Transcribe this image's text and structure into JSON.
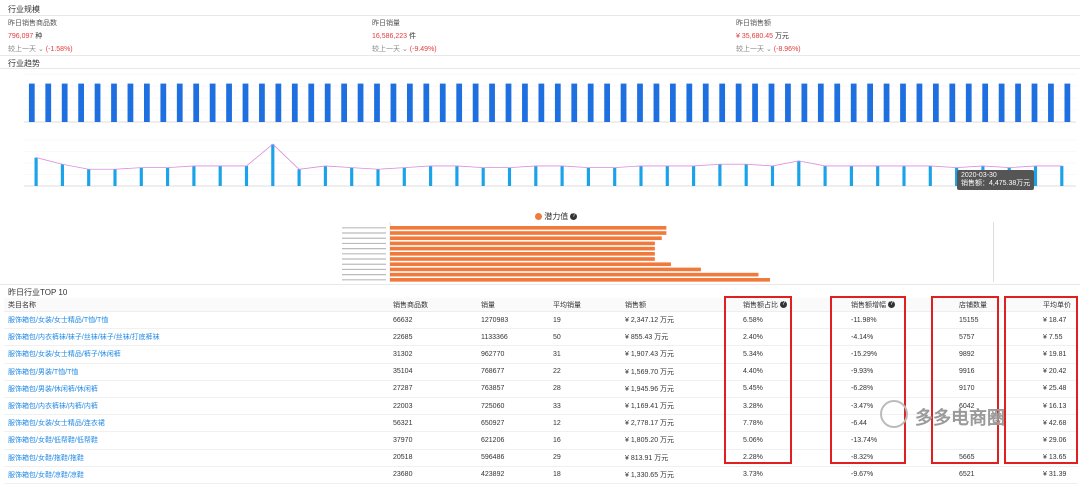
{
  "section_industry_scale": "行业规模",
  "stats": [
    {
      "label": "昨日销售商品数",
      "value": "796,097",
      "unit": "种",
      "compare": "较上一天",
      "pct": "(-1.58%)"
    },
    {
      "label": "昨日销量",
      "value": "16,586,223",
      "unit": "件",
      "compare": "较上一天",
      "pct": "(-9.49%)"
    },
    {
      "label": "昨日销售额",
      "value": "¥ 35,680.45",
      "unit": "万元",
      "compare": "较上一天",
      "pct": "(-8.96%)"
    }
  ],
  "section_trend": "行业趋势",
  "chart_data": [
    {
      "type": "bar",
      "series": [
        {
          "name": "",
          "color": "#1e6fe0",
          "values": [
            28,
            28,
            28,
            28,
            28,
            28,
            28,
            28,
            28,
            28,
            28,
            28,
            28,
            28,
            28,
            28,
            28,
            28,
            28,
            28,
            28,
            28,
            28,
            28,
            28,
            28,
            28,
            28,
            28,
            28,
            28,
            28,
            28,
            28,
            28,
            28,
            28,
            28,
            28,
            28,
            28,
            28,
            28,
            28,
            28,
            28,
            28,
            28,
            28,
            28,
            28,
            28,
            28,
            28,
            28,
            28,
            28,
            28,
            28,
            28,
            28,
            28,
            28,
            28
          ]
        }
      ],
      "ylim": [
        0,
        35
      ]
    },
    {
      "type": "bar",
      "series": [
        {
          "name": "",
          "color": "#1aa3e8",
          "values": [
            34,
            26,
            20,
            20,
            22,
            22,
            24,
            24,
            24,
            50,
            20,
            24,
            22,
            20,
            22,
            24,
            24,
            22,
            22,
            24,
            24,
            22,
            22,
            24,
            24,
            24,
            26,
            26,
            24,
            30,
            24,
            24,
            24,
            24,
            24,
            22,
            24,
            22,
            24,
            24
          ]
        },
        {
          "name": "",
          "color": "#d98ce0",
          "values": [
            34,
            26,
            20,
            20,
            22,
            22,
            24,
            24,
            24,
            50,
            20,
            24,
            22,
            20,
            22,
            24,
            24,
            22,
            22,
            24,
            24,
            22,
            22,
            24,
            24,
            24,
            26,
            26,
            24,
            30,
            24,
            24,
            24,
            24,
            24,
            22,
            24,
            22,
            24,
            24
          ]
        }
      ],
      "ylim": [
        0,
        55
      ]
    },
    {
      "type": "bar",
      "title": "潜力值",
      "series": [
        {
          "name": "",
          "color": "#f07a3c",
          "values": [
            120,
            120,
            118,
            115,
            115,
            115,
            115,
            122,
            135,
            160,
            165
          ]
        }
      ]
    }
  ],
  "potential_title": "潜力值",
  "tooltip": "2020-03-30\n销售额：4,475.38万元",
  "top10_title": "昨日行业TOP 10",
  "table": {
    "headers": [
      "类目名称",
      "销售商品数",
      "销量",
      "平均销量",
      "销售额",
      "销售额占比",
      "销售额增幅",
      "店铺数量",
      "平均单价"
    ],
    "rows": [
      [
        "服饰箱包/女装/女士精品/T恤/T恤",
        "66632",
        "1270983",
        "19",
        "¥ 2,347.12 万元",
        "6.58%",
        "-11.98%",
        "15155",
        "¥ 18.47"
      ],
      [
        "服饰箱包/内衣裤袜/袜子/丝袜/袜子/丝袜/打底裤袜",
        "22685",
        "1133366",
        "50",
        "¥ 855.43 万元",
        "2.40%",
        "-4.14%",
        "5757",
        "¥ 7.55"
      ],
      [
        "服饰箱包/女装/女士精品/裤子/休闲裤",
        "31302",
        "962770",
        "31",
        "¥ 1,907.43 万元",
        "5.34%",
        "-15.29%",
        "9892",
        "¥ 19.81"
      ],
      [
        "服饰箱包/男装/T恤/T恤",
        "35104",
        "768677",
        "22",
        "¥ 1,569.70 万元",
        "4.40%",
        "-9.93%",
        "9916",
        "¥ 20.42"
      ],
      [
        "服饰箱包/男装/休闲裤/休闲裤",
        "27287",
        "763857",
        "28",
        "¥ 1,945.96 万元",
        "5.45%",
        "-6.28%",
        "9170",
        "¥ 25.48"
      ],
      [
        "服饰箱包/内衣裤袜/内裤/内裤",
        "22003",
        "725060",
        "33",
        "¥ 1,169.41 万元",
        "3.28%",
        "-3.47%",
        "6042",
        "¥ 16.13"
      ],
      [
        "服饰箱包/女装/女士精品/连衣裙",
        "56321",
        "650927",
        "12",
        "¥ 2,778.17 万元",
        "7.78%",
        "-6.44",
        "",
        "¥ 42.68"
      ],
      [
        "服饰箱包/女鞋/低帮鞋/低帮鞋",
        "37970",
        "621206",
        "16",
        "¥ 1,805.20 万元",
        "5.06%",
        "-13.74%",
        "",
        "¥ 29.06"
      ],
      [
        "服饰箱包/女鞋/拖鞋/拖鞋",
        "20518",
        "596486",
        "29",
        "¥ 813.91 万元",
        "2.28%",
        "-8.32%",
        "5665",
        "¥ 13.65"
      ],
      [
        "服饰箱包/女鞋/凉鞋/凉鞋",
        "23680",
        "423892",
        "18",
        "¥ 1,330.65 万元",
        "3.73%",
        "-9.67%",
        "6521",
        "¥ 31.39"
      ]
    ]
  },
  "watermark": "多多电商圈"
}
